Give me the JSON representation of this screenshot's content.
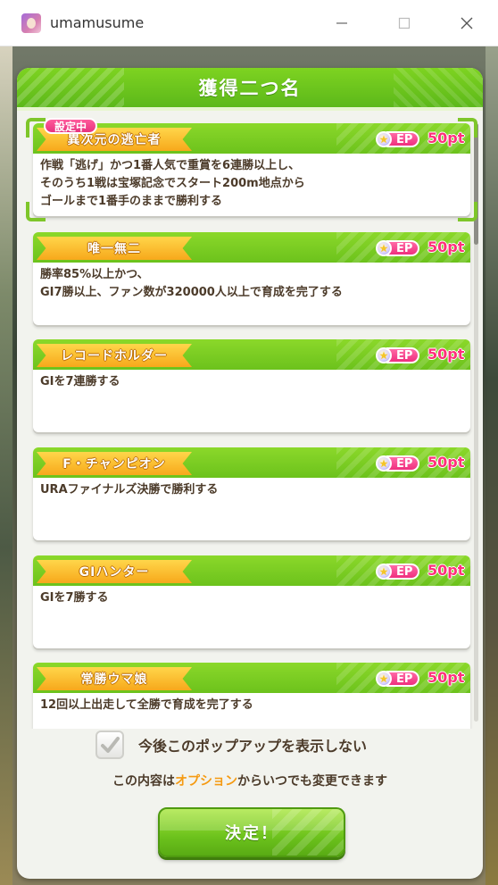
{
  "window": {
    "app_title": "umamusume"
  },
  "dialog": {
    "title": "獲得二つ名",
    "active_tag": "設定中",
    "ep_label": "EP",
    "cards": [
      {
        "name": "異次元の逃亡者",
        "points": "50pt",
        "description_lines": [
          "作戦「逃げ」かつ1番人気で重賞を6連勝以上し、",
          "そのうち1戦は宝塚記念でスタート200m地点から",
          "ゴールまで1番手のままで勝利する"
        ]
      },
      {
        "name": "唯一無二",
        "points": "50pt",
        "description_lines": [
          "勝率85%以上かつ、",
          "GⅠ7勝以上、ファン数が320000人以上で育成を完了する"
        ]
      },
      {
        "name": "レコードホルダー",
        "points": "50pt",
        "description_lines": [
          "GⅠを7連勝する"
        ]
      },
      {
        "name": "F・チャンピオン",
        "points": "50pt",
        "description_lines": [
          "URAファイナルズ決勝で勝利する"
        ]
      },
      {
        "name": "GⅠハンター",
        "points": "50pt",
        "description_lines": [
          "GⅠを7勝する"
        ]
      },
      {
        "name": "常勝ウマ娘",
        "points": "50pt",
        "description_lines": [
          "12回以上出走して全勝で育成を完了する"
        ]
      }
    ]
  },
  "footer": {
    "checkbox_label": "今後このポップアップを表示しない",
    "checkbox_checked": true,
    "note_prefix": "この内容は",
    "note_accent": "オプション",
    "note_suffix": "からいつでも変更できます",
    "confirm_label": "決定！"
  },
  "colors": {
    "accent_green": "#6cc21c",
    "ribbon_orange": "#f7a81b",
    "points_pink": "#ff2f7b",
    "text_brown": "#4c3b2a",
    "option_orange": "#f59a12"
  }
}
